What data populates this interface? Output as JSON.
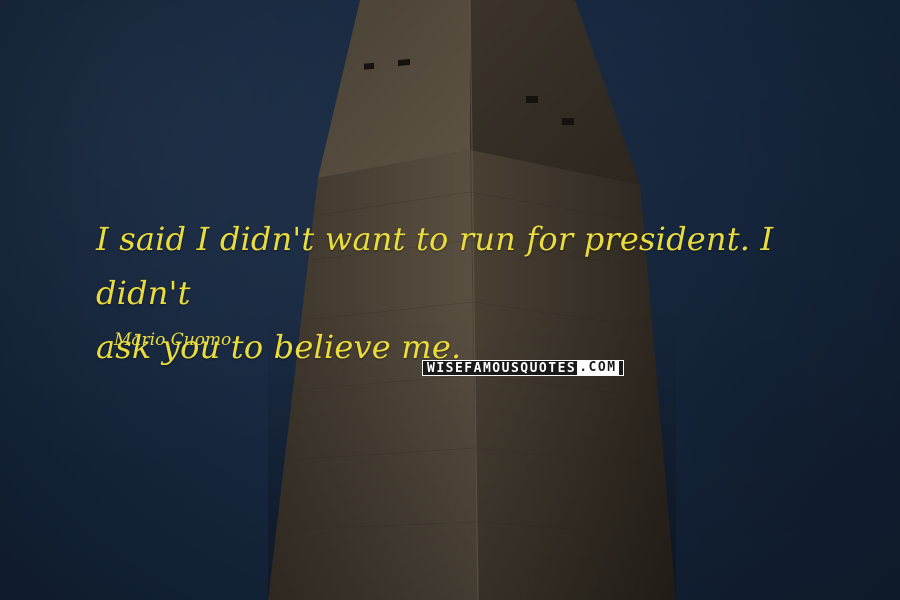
{
  "quote": {
    "line1": "I said I didn't want to run for president. I didn't",
    "line2": "ask you to believe me."
  },
  "author": "Mario Cuomo",
  "brand": {
    "name": "WISEFAMOUSQUOTES",
    "suffix": ".COM"
  },
  "colors": {
    "quote_text": "#e9dc3c",
    "sky": "#172840",
    "stone_light": "#5e5445",
    "stone_dark": "#3a3229"
  }
}
